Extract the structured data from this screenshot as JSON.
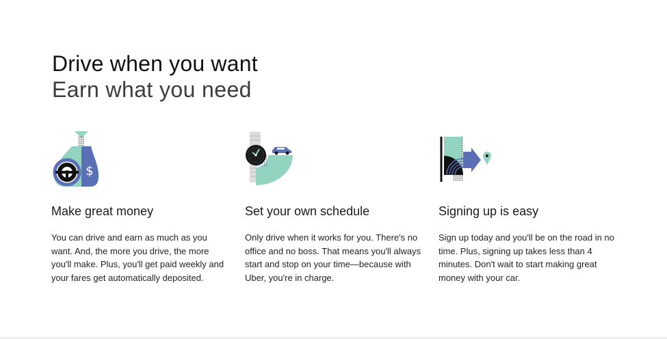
{
  "hero": {
    "title": "Drive when you want",
    "subtitle": "Earn what you need"
  },
  "features": [
    {
      "title": "Make great money",
      "body": "You can drive and earn as much as you want. And, the more you drive, the more you'll make. Plus, you'll get paid weekly and your fares get automatically deposited.",
      "icon": "money-bag-steering-wheel-icon"
    },
    {
      "title": "Set your own schedule",
      "body": "Only drive when it works for you. There's no office and no boss. That means you'll always start and stop on your time—because with Uber, you're in charge.",
      "icon": "watch-car-icon"
    },
    {
      "title": "Signing up is easy",
      "body": "Sign up today and you'll be on the road in no time. Plus, signing up takes less than 4 minutes. Don't wait to start making great money with your car.",
      "icon": "phone-signal-location-icon"
    }
  ],
  "colors": {
    "mint": "#93d4c0",
    "blue": "#5a6fb6",
    "dark": "#111111",
    "grey": "#d9d9d9"
  }
}
